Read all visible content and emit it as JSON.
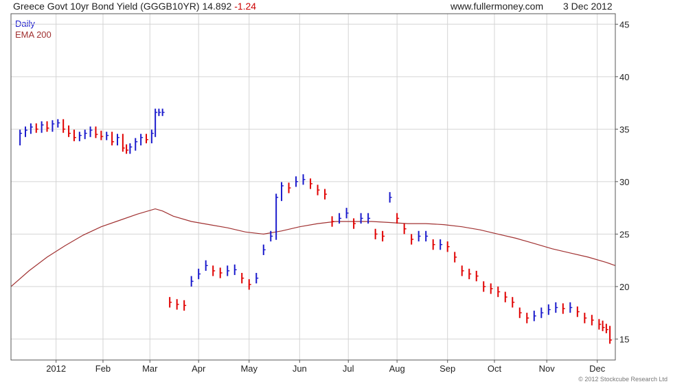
{
  "header": {
    "title": "Greece Govt 10yr Bond Yield (GGGB10YR)",
    "last": "14.892",
    "change": "-1.24",
    "site": "www.fullermoney.com",
    "date": "3 Dec 2012"
  },
  "legend": {
    "daily": "Daily",
    "ema": "EMA 200"
  },
  "copyright": "© 2012 Stockcube Research Ltd",
  "colors": {
    "up": "#1a1acc",
    "down": "#e00000",
    "ema": "#a03030",
    "grid": "#d4d4d4",
    "frame": "#555555"
  },
  "chart_data": {
    "type": "line",
    "title": "Greece Govt 10yr Bond Yield (GGGB10YR)",
    "ylim": [
      13,
      46
    ],
    "yticks": [
      15,
      20,
      25,
      30,
      35,
      40,
      45
    ],
    "xlim": [
      0,
      335
    ],
    "xticks": [
      {
        "label": "2012",
        "day": 25
      },
      {
        "label": "Feb",
        "day": 51
      },
      {
        "label": "Mar",
        "day": 77
      },
      {
        "label": "Apr",
        "day": 104
      },
      {
        "label": "May",
        "day": 132
      },
      {
        "label": "Jun",
        "day": 160
      },
      {
        "label": "Jul",
        "day": 187
      },
      {
        "label": "Aug",
        "day": 214
      },
      {
        "label": "Sep",
        "day": 242
      },
      {
        "label": "Oct",
        "day": 268
      },
      {
        "label": "Nov",
        "day": 297
      },
      {
        "label": "Dec",
        "day": 325
      }
    ],
    "grid": true,
    "series": [
      {
        "name": "Daily",
        "kind": "price",
        "points": [
          [
            2,
            33.8
          ],
          [
            5,
            34.6
          ],
          [
            8,
            34.9
          ],
          [
            11,
            35.2
          ],
          [
            14,
            35.0
          ],
          [
            17,
            35.4
          ],
          [
            20,
            35.1
          ],
          [
            23,
            35.5
          ],
          [
            26,
            35.6
          ],
          [
            29,
            35.0
          ],
          [
            32,
            34.6
          ],
          [
            35,
            34.2
          ],
          [
            38,
            34.4
          ],
          [
            41,
            34.6
          ],
          [
            44,
            34.9
          ],
          [
            47,
            34.5
          ],
          [
            50,
            34.3
          ],
          [
            53,
            34.4
          ],
          [
            56,
            33.8
          ],
          [
            59,
            34.2
          ],
          [
            62,
            33.2
          ],
          [
            64,
            33.0
          ],
          [
            66,
            33.3
          ],
          [
            69,
            33.8
          ],
          [
            72,
            34.2
          ],
          [
            75,
            34.0
          ],
          [
            78,
            34.6
          ],
          [
            80,
            36.6
          ],
          [
            82,
            36.6
          ],
          [
            84,
            36.6
          ],
          [
            88,
            18.5
          ],
          [
            92,
            18.3
          ],
          [
            96,
            18.2
          ],
          [
            100,
            20.5
          ],
          [
            104,
            21.2
          ],
          [
            108,
            22.0
          ],
          [
            112,
            21.5
          ],
          [
            116,
            21.3
          ],
          [
            120,
            21.5
          ],
          [
            124,
            21.6
          ],
          [
            128,
            20.8
          ],
          [
            132,
            20.2
          ],
          [
            136,
            20.8
          ],
          [
            140,
            23.5
          ],
          [
            144,
            24.8
          ],
          [
            147,
            28.5
          ],
          [
            150,
            29.6
          ],
          [
            154,
            29.4
          ],
          [
            158,
            30.0
          ],
          [
            162,
            30.2
          ],
          [
            166,
            29.8
          ],
          [
            170,
            29.2
          ],
          [
            174,
            28.8
          ],
          [
            178,
            26.2
          ],
          [
            182,
            26.5
          ],
          [
            186,
            27.0
          ],
          [
            190,
            26.0
          ],
          [
            194,
            26.5
          ],
          [
            198,
            26.5
          ],
          [
            202,
            25.0
          ],
          [
            206,
            24.8
          ],
          [
            210,
            28.5
          ],
          [
            214,
            26.5
          ],
          [
            218,
            25.5
          ],
          [
            222,
            24.5
          ],
          [
            226,
            24.8
          ],
          [
            230,
            24.8
          ],
          [
            234,
            24.0
          ],
          [
            238,
            24.0
          ],
          [
            242,
            23.8
          ],
          [
            246,
            22.8
          ],
          [
            250,
            21.5
          ],
          [
            254,
            21.2
          ],
          [
            258,
            21.0
          ],
          [
            262,
            20.0
          ],
          [
            266,
            19.8
          ],
          [
            270,
            19.5
          ],
          [
            274,
            19.0
          ],
          [
            278,
            18.5
          ],
          [
            282,
            17.5
          ],
          [
            286,
            17.0
          ],
          [
            290,
            17.2
          ],
          [
            294,
            17.5
          ],
          [
            298,
            17.8
          ],
          [
            302,
            18.0
          ],
          [
            306,
            17.9
          ],
          [
            310,
            18.0
          ],
          [
            314,
            17.6
          ],
          [
            318,
            17.0
          ],
          [
            322,
            16.8
          ],
          [
            326,
            16.4
          ],
          [
            328,
            16.1
          ],
          [
            330,
            15.9
          ],
          [
            332,
            14.9
          ]
        ]
      },
      {
        "name": "EMA 200",
        "kind": "line",
        "points": [
          [
            0,
            20.0
          ],
          [
            10,
            21.5
          ],
          [
            20,
            22.8
          ],
          [
            30,
            23.9
          ],
          [
            40,
            24.9
          ],
          [
            50,
            25.7
          ],
          [
            60,
            26.3
          ],
          [
            70,
            26.9
          ],
          [
            80,
            27.4
          ],
          [
            84,
            27.2
          ],
          [
            90,
            26.7
          ],
          [
            100,
            26.2
          ],
          [
            110,
            25.9
          ],
          [
            120,
            25.6
          ],
          [
            130,
            25.2
          ],
          [
            140,
            25.0
          ],
          [
            150,
            25.3
          ],
          [
            160,
            25.7
          ],
          [
            170,
            26.0
          ],
          [
            180,
            26.2
          ],
          [
            190,
            26.2
          ],
          [
            200,
            26.2
          ],
          [
            210,
            26.1
          ],
          [
            220,
            26.0
          ],
          [
            230,
            26.0
          ],
          [
            240,
            25.9
          ],
          [
            250,
            25.7
          ],
          [
            260,
            25.4
          ],
          [
            270,
            25.0
          ],
          [
            280,
            24.6
          ],
          [
            290,
            24.1
          ],
          [
            300,
            23.6
          ],
          [
            310,
            23.2
          ],
          [
            320,
            22.8
          ],
          [
            330,
            22.3
          ],
          [
            335,
            22.0
          ]
        ]
      }
    ]
  }
}
